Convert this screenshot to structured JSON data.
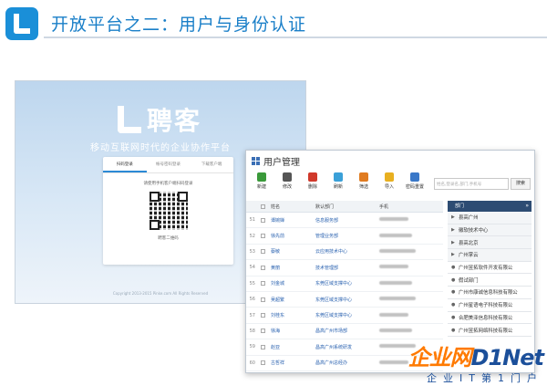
{
  "slide": {
    "title": "开放平台之二：用户与身份认证"
  },
  "login": {
    "brand": "聘客",
    "tagline": "移动互联网时代的企业协作平台",
    "tabs": [
      "扫码登录",
      "帐号密码登录",
      "下载客户端"
    ],
    "hint": "请使用手机客户端扫码登录",
    "scan_label": "聘客二维码",
    "copyright": "Copyright 2013-2015 Pinke.com All Rights Reserved"
  },
  "user_mgmt": {
    "title": "用户管理",
    "toolbar": [
      {
        "label": "新建",
        "color": "#3a9a3a"
      },
      {
        "label": "修改",
        "color": "#555555"
      },
      {
        "label": "删除",
        "color": "#d0392b"
      },
      {
        "label": "刷新",
        "color": "#3aa0d8"
      },
      {
        "label": "筛选",
        "color": "#e07b20"
      },
      {
        "label": "导入",
        "color": "#e8b020"
      },
      {
        "label": "密码重置",
        "color": "#3a78c8"
      }
    ],
    "search_placeholder": "姓名,登录名,部门,手机号",
    "search_button": "搜索",
    "columns": [
      "姓名",
      "默认部门",
      "手机"
    ],
    "rows": [
      {
        "idx": "51",
        "name": "谭婉婵",
        "dept": "信息服务部"
      },
      {
        "idx": "52",
        "name": "徐先前",
        "dept": "管理业务部"
      },
      {
        "idx": "53",
        "name": "蔡敏",
        "dept": "云应用技术中心"
      },
      {
        "idx": "54",
        "name": "黄丽",
        "dept": "技术管理部"
      },
      {
        "idx": "55",
        "name": "刘金城",
        "dept": "东莞区域支撑中心"
      },
      {
        "idx": "56",
        "name": "吴超繁",
        "dept": "东莞区域支撑中心"
      },
      {
        "idx": "57",
        "name": "刘桂东",
        "dept": "东莞区域支撑中心"
      },
      {
        "idx": "58",
        "name": "徐海",
        "dept": "昌高广州市场部"
      },
      {
        "idx": "59",
        "name": "赵亚",
        "dept": "昌高广州系统研发"
      },
      {
        "idx": "60",
        "name": "古哲祥",
        "dept": "昌高广州总经办"
      }
    ],
    "dept_header": "部门",
    "dept_items": [
      {
        "label": "县高广州",
        "group": true
      },
      {
        "label": "徽软技术中心",
        "group": true
      },
      {
        "label": "县高北京",
        "group": true
      },
      {
        "label": "广州掌云",
        "group": true
      },
      {
        "label": "广州昱拓软件开发有限公",
        "group": false
      },
      {
        "label": "假试部门",
        "group": false
      },
      {
        "label": "广州市康诚信息科技有限公",
        "group": false
      },
      {
        "label": "广州星语电子科技有限公",
        "group": false
      },
      {
        "label": "合肥美泽信息科技有限公",
        "group": false
      },
      {
        "label": "广州昱拓网络科技有限公",
        "group": false
      }
    ]
  },
  "watermark": {
    "brand_a": "企业网",
    "brand_b": "D1Net",
    "slogan": "企业IT第1门户"
  }
}
